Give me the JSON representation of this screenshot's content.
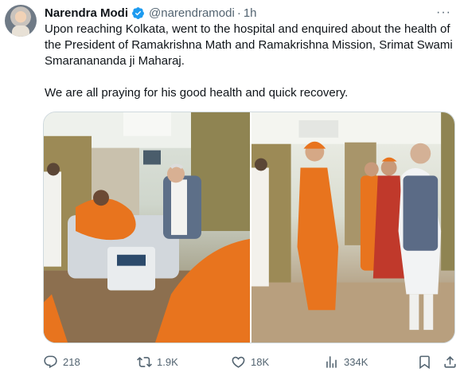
{
  "tweet": {
    "author_name": "Narendra Modi",
    "handle": "@narendramodi",
    "separator": "·",
    "time": "1h",
    "more_label": "···",
    "verified_color": "#1d9bf0",
    "paragraphs": [
      "Upon reaching Kolkata, went to the hospital and enquired about the health of the President of Ramakrishna Math and Ramakrishna Mission, Srimat Swami Smaranananda ji Maharaj.",
      "We are all praying for his good health and quick recovery."
    ],
    "media": [
      {
        "icon": "photo-hospital-bedside-visit"
      },
      {
        "icon": "photo-hospital-corridor-greeting"
      }
    ],
    "actions": {
      "reply_count": "218",
      "retweet_count": "1.9K",
      "like_count": "18K",
      "view_count": "334K"
    },
    "colors": {
      "text_primary": "#0f1419",
      "text_secondary": "#536471",
      "saffron": "#e8741e"
    }
  }
}
